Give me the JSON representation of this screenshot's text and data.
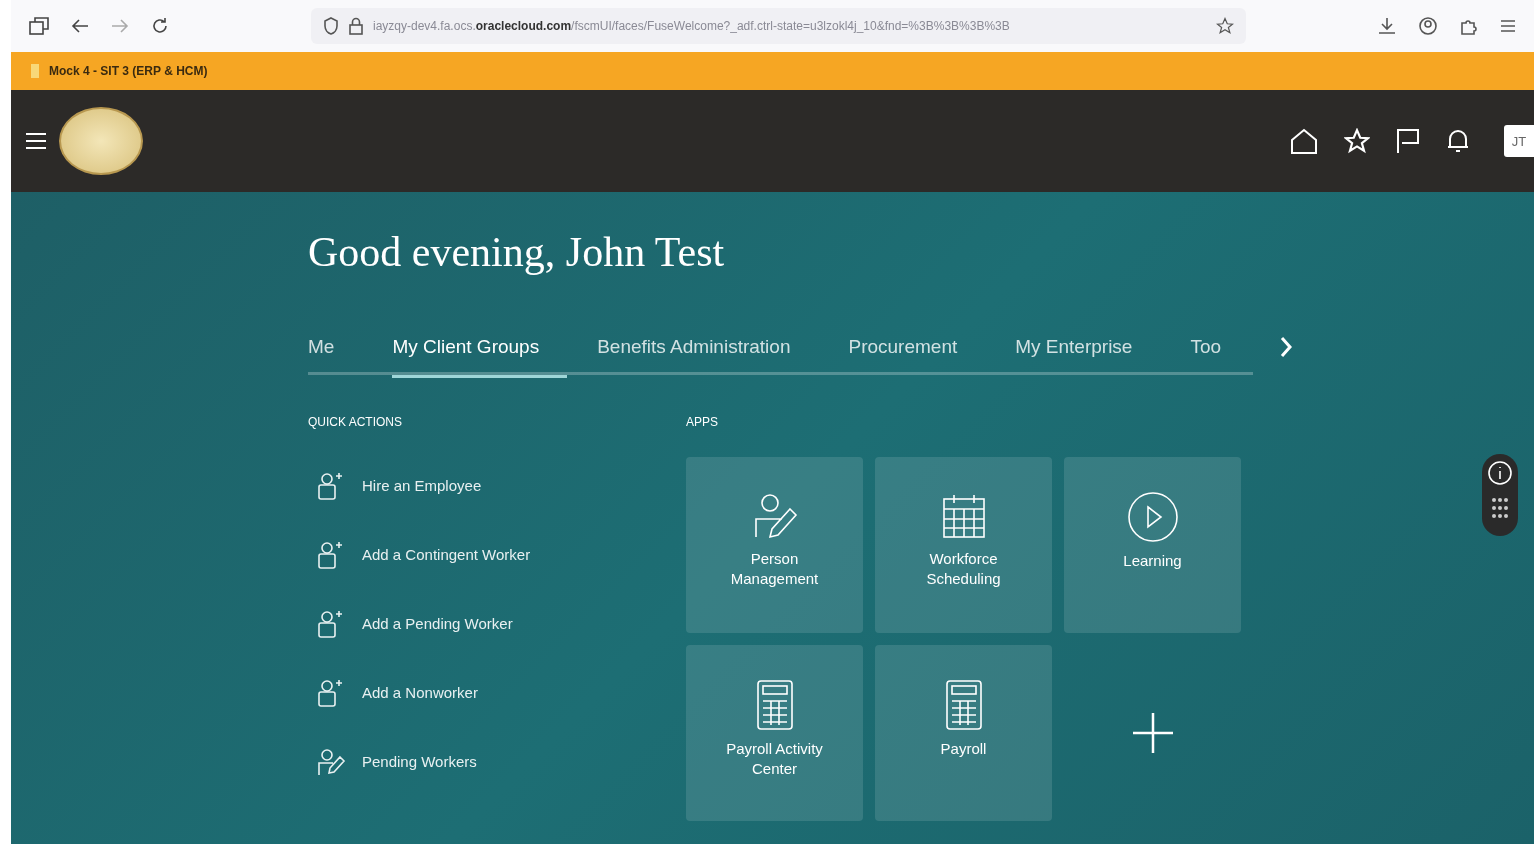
{
  "browser": {
    "url_host_prefix": "iayzqy-dev4.fa.ocs.",
    "url_domain": "oraclecloud.com",
    "url_rest": "/fscmUI/faces/FuseWelcome?_adf.ctrl-state=u3lzokl4j_10&fnd=%3B%3B%3B%3B"
  },
  "banner": {
    "text": "Mock 4 - SIT 3 (ERP & HCM)"
  },
  "header": {
    "avatar": "JT"
  },
  "greeting": "Good evening, John Test",
  "tabs": [
    {
      "label": "Me",
      "selected": false
    },
    {
      "label": "My Client Groups",
      "selected": true
    },
    {
      "label": "Benefits Administration",
      "selected": false
    },
    {
      "label": "Procurement",
      "selected": false
    },
    {
      "label": "My Enterprise",
      "selected": false
    },
    {
      "label": "Too",
      "selected": false
    }
  ],
  "quick_actions": {
    "title": "QUICK ACTIONS",
    "items": [
      {
        "label": "Hire an Employee",
        "kind": "add"
      },
      {
        "label": "Add a Contingent Worker",
        "kind": "add"
      },
      {
        "label": "Add a Pending Worker",
        "kind": "add"
      },
      {
        "label": "Add a Nonworker",
        "kind": "add"
      },
      {
        "label": "Pending Workers",
        "kind": "edit"
      }
    ]
  },
  "apps": {
    "title": "APPS",
    "tiles": [
      {
        "label": "Person Management",
        "kind": "person"
      },
      {
        "label": "Workforce Scheduling",
        "kind": "calendar"
      },
      {
        "label": "Learning",
        "kind": "play"
      },
      {
        "label": "Payroll Activity Center",
        "kind": "calculator"
      },
      {
        "label": "Payroll",
        "kind": "calculator"
      },
      {
        "kind": "add"
      }
    ]
  }
}
